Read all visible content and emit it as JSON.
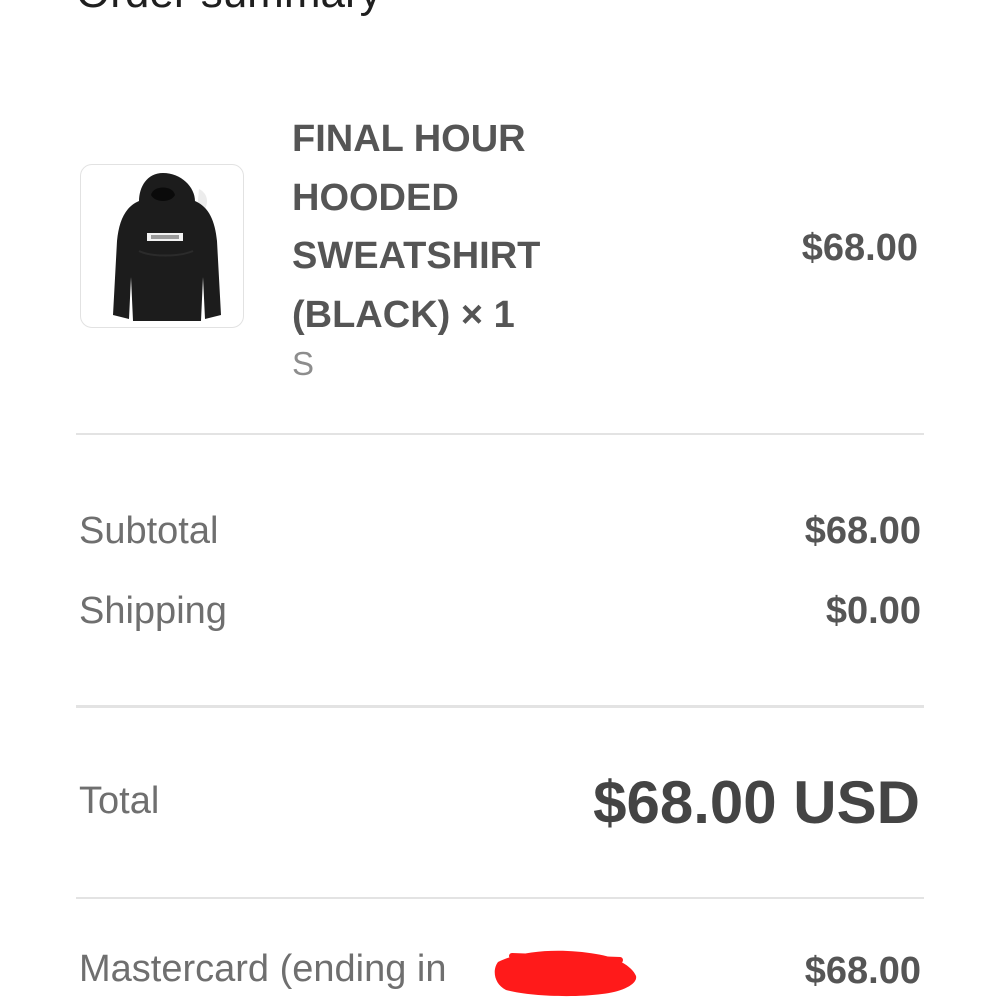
{
  "page": {
    "title": "Order summary"
  },
  "line_item": {
    "image_icon": "hooded-sweatshirt-product-photo",
    "name": "FINAL HOUR HOODED SWEATSHIRT (BLACK) × 1",
    "variant": "S",
    "price": "$68.00"
  },
  "summary": {
    "subtotal_label": "Subtotal",
    "subtotal_value": "$68.00",
    "shipping_label": "Shipping",
    "shipping_value": "$0.00"
  },
  "total": {
    "label": "Total",
    "value": "$68.00 USD"
  },
  "payment": {
    "method_label": "Mastercard (ending in",
    "amount": "$68.00",
    "redaction_color": "#ff1a1a"
  },
  "colors": {
    "background": "#ffffff",
    "primary_text": "#555555",
    "secondary_text": "#6f6f6f",
    "divider": "#e3e3e3"
  }
}
